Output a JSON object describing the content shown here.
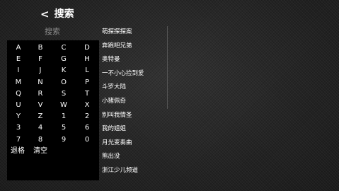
{
  "header": {
    "back_icon": "<",
    "title": "搜索"
  },
  "search": {
    "placeholder": "搜索"
  },
  "keyboard": {
    "rows": [
      [
        "A",
        "B",
        "C",
        "D"
      ],
      [
        "E",
        "F",
        "G",
        "H"
      ],
      [
        "I",
        "J",
        "K",
        "L"
      ],
      [
        "M",
        "N",
        "O",
        "P"
      ],
      [
        "Q",
        "R",
        "S",
        "T"
      ],
      [
        "U",
        "V",
        "W",
        "X"
      ],
      [
        "Y",
        "Z",
        "1",
        "2"
      ],
      [
        "3",
        "4",
        "5",
        "6"
      ],
      [
        "7",
        "8",
        "9",
        "0"
      ]
    ],
    "delete_label": "退格",
    "clear_label": "清空"
  },
  "results": [
    "萌探探探案",
    "奔跑吧兄弟",
    "奥特曼",
    "一不小心捡到爱",
    "斗罗大陆",
    "小猪佩奇",
    "别叫我情圣",
    "我的姐姐",
    "月光变奏曲",
    "熊出没",
    "浙江少儿频道"
  ]
}
